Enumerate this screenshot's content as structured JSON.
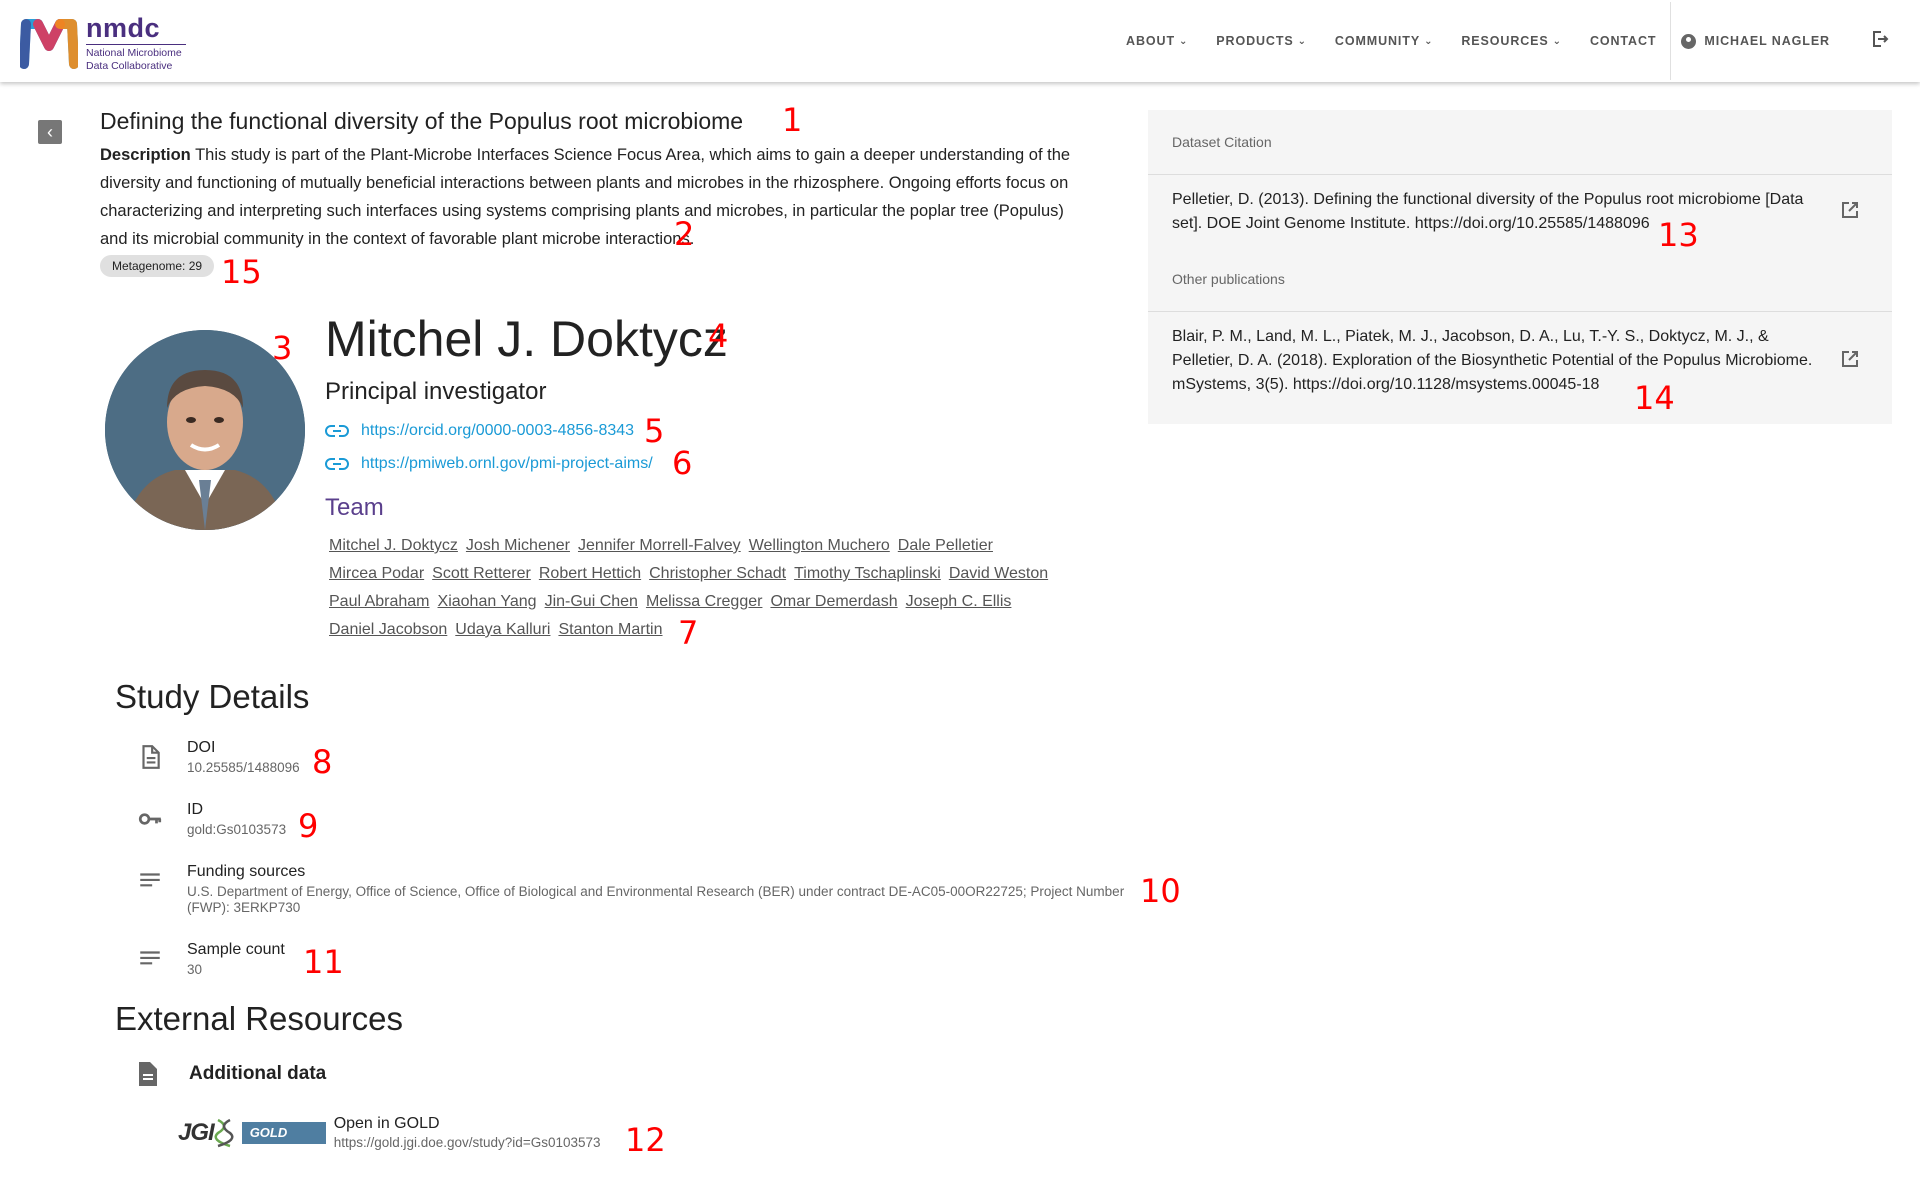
{
  "header": {
    "logo_name": "nmdc",
    "logo_sub_1": "National Microbiome",
    "logo_sub_2": "Data Collaborative",
    "nav": [
      "ABOUT",
      "PRODUCTS",
      "COMMUNITY",
      "RESOURCES"
    ],
    "contact": "CONTACT",
    "user_name": "MICHAEL NAGLER"
  },
  "study": {
    "title": "Defining the functional diversity of the Populus root microbiome",
    "description_label": "Description",
    "description": "This study is part of the Plant-Microbe Interfaces Science Focus Area, which aims to gain a deeper understanding of the diversity and functioning of mutually beneficial interactions between plants and microbes in the rhizosphere. Ongoing efforts focus on characterizing and interpreting such interfaces using systems comprising plants and microbes, in particular the poplar tree (Populus) and its microbial community in the context of favorable plant microbe interactions.",
    "chip": "Metagenome: 29"
  },
  "pi": {
    "name": "Mitchel J. Doktycz",
    "role": "Principal investigator",
    "orcid": "https://orcid.org/0000-0003-4856-8343",
    "website": "https://pmiweb.ornl.gov/pmi-project-aims/",
    "team_title": "Team",
    "team_rows": [
      [
        "Mitchel J. Doktycz",
        "Josh Michener",
        "Jennifer Morrell-Falvey",
        "Wellington Muchero",
        "Dale Pelletier"
      ],
      [
        "Mircea Podar",
        "Scott Retterer",
        "Robert Hettich",
        "Christopher Schadt",
        "Timothy Tschaplinski",
        "David Weston"
      ],
      [
        "Paul Abraham",
        "Xiaohan Yang",
        "Jin-Gui Chen",
        "Melissa Cregger",
        "Omar Demerdash",
        "Joseph C. Ellis"
      ],
      [
        "Daniel Jacobson",
        "Udaya Kalluri",
        "Stanton Martin"
      ]
    ]
  },
  "details": {
    "title": "Study Details",
    "doi_label": "DOI",
    "doi_value": "10.25585/1488096",
    "id_label": "ID",
    "id_value": "gold:Gs0103573",
    "funding_label": "Funding sources",
    "funding_value_1": "U.S. Department of Energy, Office of Science, Office of Biological and Environmental Research (BER) under contract DE-AC05-00OR22725; Project Number",
    "funding_value_2": "(FWP): 3ERKP730",
    "sample_label": "Sample count",
    "sample_value": "30"
  },
  "external": {
    "title": "External Resources",
    "additional": "Additional data",
    "jgi": "JGI",
    "gold": "GOLD",
    "gold_label": "Open in GOLD",
    "gold_url": "https://gold.jgi.doe.gov/study?id=Gs0103573"
  },
  "panel": {
    "citation_head": "Dataset Citation",
    "citation": "Pelletier, D. (2013). Defining the functional diversity of the Populus root microbiome [Data set]. DOE Joint Genome Institute. https://doi.org/10.25585/1488096",
    "other_head": "Other publications",
    "other": "Blair, P. M., Land, M. L., Piatek, M. J., Jacobson, D. A., Lu, T.-Y. S., Doktycz, M. J., & Pelletier, D. A. (2018). Exploration of the Biosynthetic Potential of the Populus Microbiome. mSystems, 3(5). https://doi.org/10.1128/msystems.00045-18"
  },
  "annotations": [
    "1",
    "2",
    "3",
    "4",
    "5",
    "6",
    "7",
    "8",
    "9",
    "10",
    "11",
    "12",
    "13",
    "14",
    "15"
  ],
  "colors": {
    "accent_purple": "#5a3f8c",
    "link_blue": "#1a9ad6",
    "annotation_red": "#ff0000"
  },
  "icons": [
    "nmdc-logo-icon",
    "chevron-down-icon",
    "account-circle-icon",
    "logout-icon",
    "chevron-left-icon",
    "link-icon",
    "file-document-icon",
    "key-icon",
    "text-lines-icon",
    "dna-icon",
    "open-in-new-icon"
  ]
}
